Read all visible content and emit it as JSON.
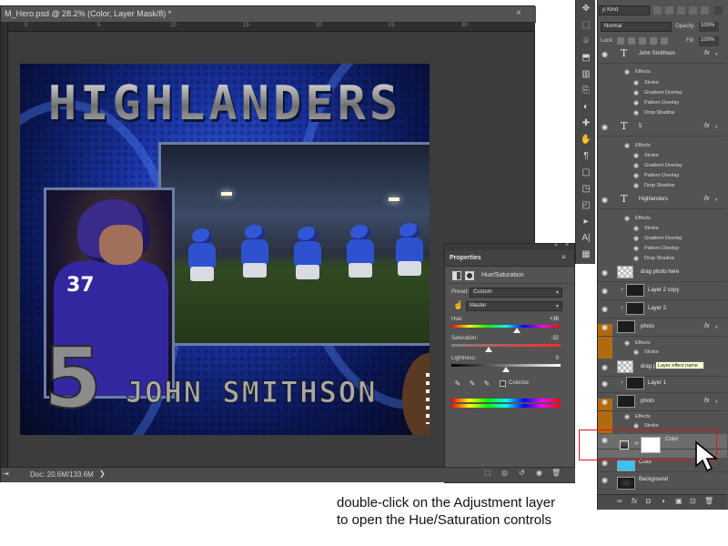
{
  "document": {
    "title": "M_Hero.psd @ 28.2% (Color, Layer Mask/8) *",
    "close": "×",
    "ruler_ticks": [
      "0",
      "5",
      "10",
      "15",
      "20",
      "25",
      "30"
    ],
    "status_icon": "⇥",
    "status": "Doc: 20.6M/133.6M",
    "status_arrow": "❯"
  },
  "poster": {
    "title": "HIGHLANDERS",
    "number": "5",
    "name": "JOHN SMITHSON",
    "jersey_number": "37"
  },
  "properties": {
    "panel_title": "Properties",
    "collapse": "«",
    "close": "×",
    "menu": "≡",
    "adjustment_type": "Hue/Saturation",
    "preset_label": "Preset:",
    "preset_value": "Custom",
    "channel_value": "Master",
    "hand": "☝",
    "hue_label": "Hue:",
    "hue_value": "+36",
    "hue_level": 0.6,
    "saturation_label": "Saturation:",
    "saturation_value": "-32",
    "saturation_level": 0.34,
    "lightness_label": "Lightness:",
    "lightness_value": "0",
    "lightness_level": 0.5,
    "eyedroppers": [
      "✎",
      "✎",
      "✎"
    ],
    "colorize_label": "Colorize",
    "colorize_checked": false,
    "footer_icons": [
      "⬚",
      "◎",
      "↺",
      "◉",
      "🗑"
    ]
  },
  "tools": [
    "✥",
    "⬚",
    "⌾",
    "⬒",
    "▥",
    "⎘",
    "◐",
    "✚",
    "✋",
    "¶",
    "▢",
    "◳",
    "◰",
    "▸",
    "A|",
    "▦"
  ],
  "layers": {
    "filter_label": "ρ Kind",
    "blend_mode": "Normal",
    "opacity_label": "Opacity:",
    "opacity_value": "100%",
    "lock_label": "Lock:",
    "fill_label": "Fill:",
    "fill_value": "100%",
    "fx_label": "fx",
    "eye": "◉",
    "text_layer_icon": "T",
    "link": "⇡",
    "rows": [
      {
        "name": "John Smithson",
        "type": "text",
        "fx": true
      },
      {
        "name": "Effects"
      },
      {
        "name": "Stroke"
      },
      {
        "name": "Gradient Overlay"
      },
      {
        "name": "Pattern Overlay"
      },
      {
        "name": "Drop Shadow"
      },
      {
        "name": "5",
        "type": "text",
        "fx": true
      },
      {
        "name": "Effects"
      },
      {
        "name": "Stroke"
      },
      {
        "name": "Gradient Overlay"
      },
      {
        "name": "Pattern Overlay"
      },
      {
        "name": "Drop Shadow"
      },
      {
        "name": "Highlanders",
        "type": "text",
        "fx": true
      },
      {
        "name": "Effects"
      },
      {
        "name": "Stroke"
      },
      {
        "name": "Gradient Overlay"
      },
      {
        "name": "Pattern Overlay"
      },
      {
        "name": "Drop Shadow"
      },
      {
        "name": "drag photo here"
      },
      {
        "name": "Layer 2 copy"
      },
      {
        "name": "Layer 2"
      },
      {
        "name": "photo",
        "fx": true
      },
      {
        "name": "Effects"
      },
      {
        "name": "Stroke"
      },
      {
        "name": "drag photo here"
      },
      {
        "name": "Layer 1"
      },
      {
        "name": "photo",
        "fx": true
      },
      {
        "name": "Effects"
      },
      {
        "name": "Stroke"
      },
      {
        "name": "Color",
        "adjustment": true,
        "selected": true
      },
      {
        "name": "Color"
      },
      {
        "name": "Background"
      }
    ],
    "tooltip": "Layer effect name",
    "footer_icons": [
      "∞",
      "fx",
      "◘",
      "◑",
      "▣",
      "⊡",
      "🗑"
    ]
  },
  "caption": {
    "line1": "double-click on the Adjustment layer",
    "line2": "to open the Hue/Saturation controls"
  },
  "colors": {
    "accent_orange": "#b26a10",
    "highlight_red": "#e0141b",
    "panel_gray": "#535353"
  }
}
